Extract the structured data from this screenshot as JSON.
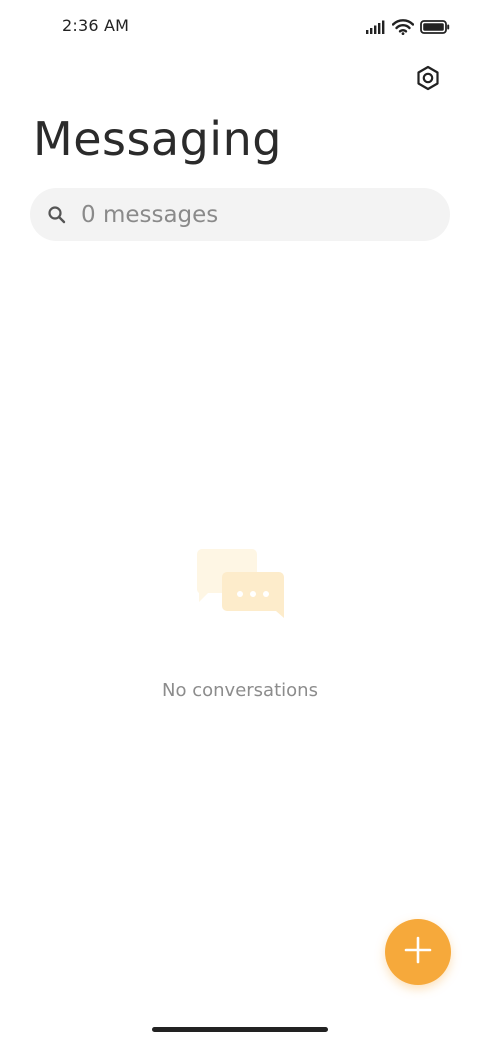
{
  "status_bar": {
    "time": "2:36 AM",
    "icons": [
      "signal-icon",
      "wifi-icon",
      "battery-icon"
    ]
  },
  "header": {
    "title": "Messaging",
    "settings_icon": "gear-icon"
  },
  "search": {
    "placeholder": "0 messages",
    "value": "",
    "icon": "search-icon"
  },
  "empty_state": {
    "icon": "chat-bubbles-icon",
    "text": "No conversations"
  },
  "fab": {
    "icon": "plus-icon"
  },
  "colors": {
    "accent": "#f6a93b",
    "illustration": "#fdeccb",
    "search_background": "#f3f3f3"
  }
}
